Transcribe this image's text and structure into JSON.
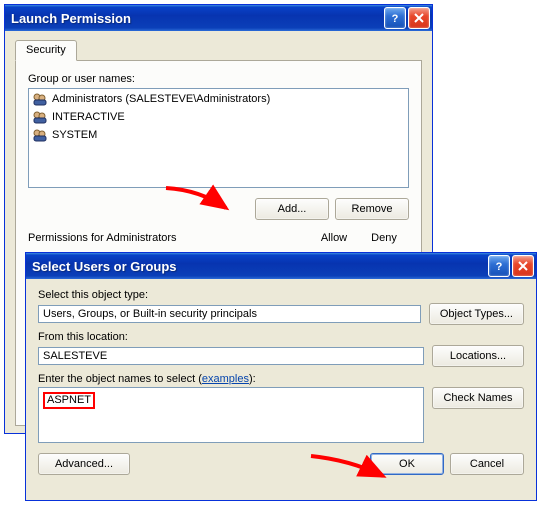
{
  "dialog1": {
    "title": "Launch Permission",
    "tab_security": "Security",
    "group_label": "Group or user names:",
    "items": [
      {
        "name": "Administrators (SALESTEVE\\Administrators)"
      },
      {
        "name": "INTERACTIVE"
      },
      {
        "name": "SYSTEM"
      }
    ],
    "add_btn": "Add...",
    "remove_btn": "Remove",
    "perm_label": "Permissions for Administrators",
    "col_allow": "Allow",
    "col_deny": "Deny"
  },
  "dialog2": {
    "title": "Select Users or Groups",
    "obj_label": "Select this object type:",
    "obj_value": "Users, Groups, or Built-in security principals",
    "obj_btn": "Object Types...",
    "loc_label": "From this location:",
    "loc_value": "SALESTEVE",
    "loc_btn": "Locations...",
    "enter_label_a": "Enter the object names to select (",
    "enter_label_link": "examples",
    "enter_label_b": "):",
    "enter_value": "ASPNET",
    "check_btn": "Check Names",
    "advanced_btn": "Advanced...",
    "ok_btn": "OK",
    "cancel_btn": "Cancel"
  }
}
